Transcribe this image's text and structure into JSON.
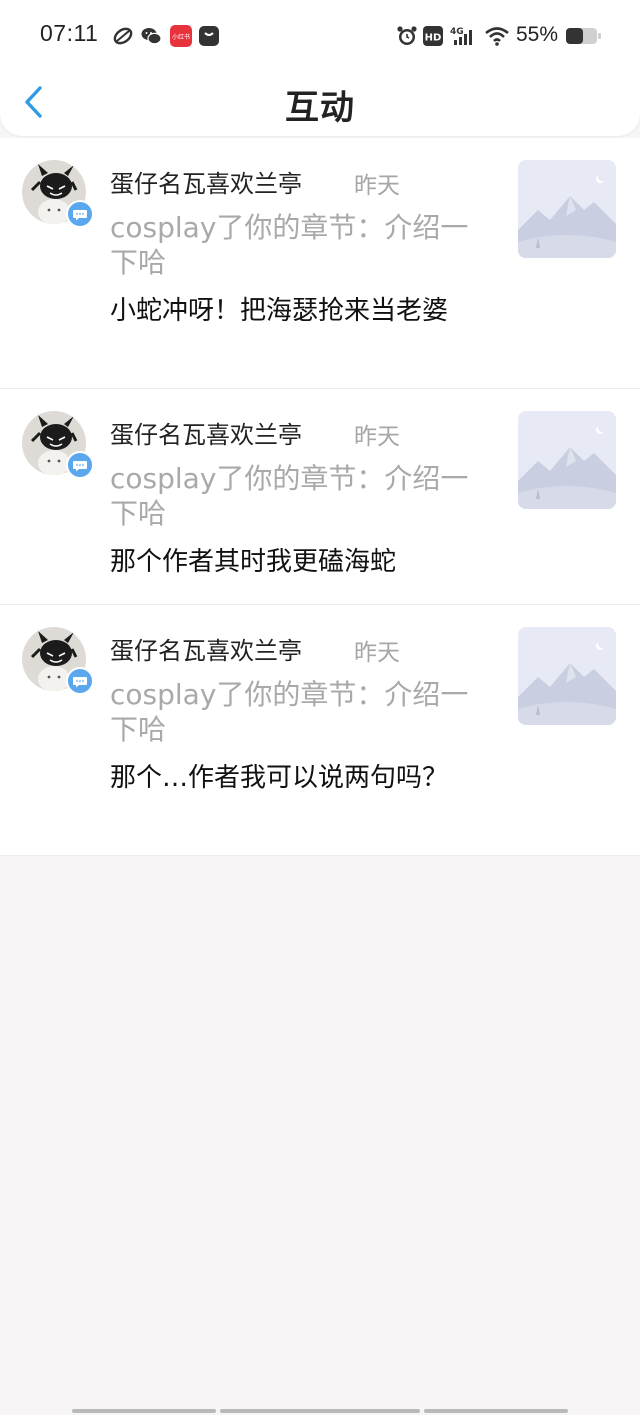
{
  "status_bar": {
    "time": "07:11",
    "battery": "55%",
    "icons": [
      "sync-icon",
      "wechat-icon",
      "app-badge-icon",
      "bag-icon",
      "alarm-icon",
      "hd-icon",
      "4g-signal-icon",
      "wifi-icon",
      "battery-icon"
    ],
    "hd_label": "HD",
    "network_label": "4G",
    "app_badge_label": "小红书"
  },
  "header": {
    "title": "互动",
    "back_icon": "chevron-left-icon",
    "accent_color": "#2f9be6"
  },
  "notifications": [
    {
      "username": "蛋仔名瓦喜欢兰亭",
      "time": "昨天",
      "reference": "cosplay了你的章节：介绍一下哈",
      "message": "小蛇冲呀！把海瑟抢来当老婆"
    },
    {
      "username": "蛋仔名瓦喜欢兰亭",
      "time": "昨天",
      "reference": "cosplay了你的章节：介绍一下哈",
      "message": "那个作者其时我更磕海蛇"
    },
    {
      "username": "蛋仔名瓦喜欢兰亭",
      "time": "昨天",
      "reference": "cosplay了你的章节：介绍一下哈",
      "message": "那个…作者我可以说两句吗？"
    }
  ]
}
